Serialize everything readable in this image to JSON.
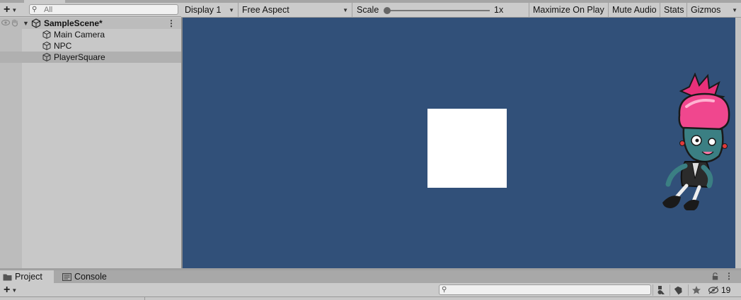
{
  "hierarchy": {
    "add_icon": "plus-icon",
    "search_placeholder": "All",
    "scene_name": "SampleScene*",
    "items": [
      {
        "label": "Main Camera",
        "icon": "gameobject-cube-icon"
      },
      {
        "label": "NPC",
        "icon": "gameobject-cube-icon"
      },
      {
        "label": "PlayerSquare",
        "icon": "gameobject-cube-icon",
        "selected": true
      }
    ]
  },
  "game_toolbar": {
    "display": "Display 1",
    "aspect": "Free Aspect",
    "scale_label": "Scale",
    "scale_value": "1x",
    "scale": 0.0,
    "maximize_on_play": "Maximize On Play",
    "mute_audio": "Mute Audio",
    "stats": "Stats",
    "gizmos": "Gizmos"
  },
  "game_view": {
    "background_color": "#315079",
    "square_color": "#ffffff",
    "npc_sprite": "zombie-character-sprite"
  },
  "bottom_panel": {
    "tabs": [
      {
        "label": "Project",
        "icon": "folder-icon",
        "active": true
      },
      {
        "label": "Console",
        "icon": "console-icon",
        "active": false
      }
    ],
    "hidden_count": "19",
    "icons": [
      "filter-by-type-icon",
      "label-tag-icon",
      "star-icon",
      "hidden-packages-icon"
    ]
  }
}
